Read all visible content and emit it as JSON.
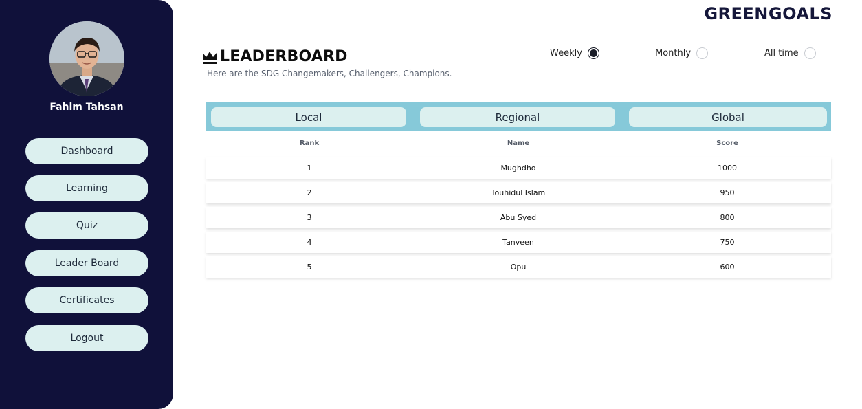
{
  "brand": {
    "logo_text": "GREENGOALS"
  },
  "user": {
    "name": "Fahim Tahsan"
  },
  "sidebar": {
    "items": [
      {
        "label": "Dashboard"
      },
      {
        "label": "Learning"
      },
      {
        "label": "Quiz"
      },
      {
        "label": "Leader Board"
      },
      {
        "label": "Certificates"
      },
      {
        "label": "Logout"
      }
    ]
  },
  "page": {
    "title": "LEADERBOARD",
    "subtitle": "Here are the SDG Changemakers, Challengers, Champions."
  },
  "period_options": [
    {
      "label": "Weekly",
      "selected": true
    },
    {
      "label": "Monthly",
      "selected": false
    },
    {
      "label": "All time",
      "selected": false
    }
  ],
  "scope_tabs": [
    {
      "label": "Local"
    },
    {
      "label": "Regional"
    },
    {
      "label": "Global"
    }
  ],
  "table": {
    "headers": {
      "rank": "Rank",
      "name": "Name",
      "score": "Score"
    },
    "rows": [
      {
        "rank": "1",
        "name": "Mughdho",
        "score": "1000"
      },
      {
        "rank": "2",
        "name": "Touhidul Islam",
        "score": "950"
      },
      {
        "rank": "3",
        "name": "Abu Syed",
        "score": "800"
      },
      {
        "rank": "4",
        "name": "Tanveen",
        "score": "750"
      },
      {
        "rank": "5",
        "name": "Opu",
        "score": "600"
      }
    ]
  },
  "colors": {
    "sidebar_bg": "#10113a",
    "pill_bg": "#dcf0ef",
    "scope_bar_bg": "#86c9d9"
  }
}
